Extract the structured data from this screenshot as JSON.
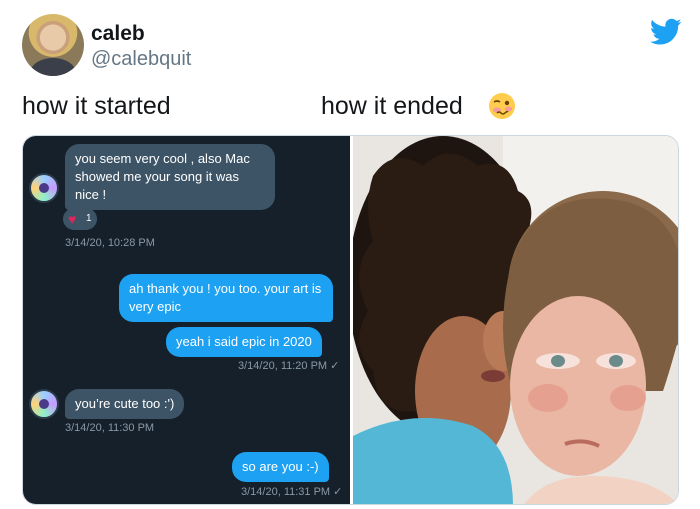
{
  "author": {
    "display_name": "caleb",
    "handle": "@calebquit"
  },
  "captions": {
    "left": "how it started",
    "right": "how it ended",
    "right_emoji": "woozy-face-icon"
  },
  "icons": {
    "brand": "twitter-bird-icon",
    "brand_color": "#1da1f2"
  },
  "dm": {
    "messages": [
      {
        "from": "them",
        "text": "you seem very cool , also Mac showed me your song it was nice !"
      },
      {
        "from": "me",
        "text": "ah thank you ! you too. your art is very epic"
      },
      {
        "from": "me",
        "text": "yeah i said epic in 2020"
      },
      {
        "from": "them",
        "text": "you’re cute too :')"
      },
      {
        "from": "me",
        "text": "so are you :-)"
      }
    ],
    "reaction": {
      "icon": "heart-icon",
      "count": "1"
    },
    "timestamps": [
      "3/14/20, 10:28 PM",
      "3/14/20, 11:20 PM ✓",
      "3/14/20, 11:30 PM",
      "3/14/20, 11:31 PM ✓"
    ],
    "colors": {
      "background": "#15202b",
      "incoming": "#3d5466",
      "outgoing": "#1da1f2"
    }
  }
}
